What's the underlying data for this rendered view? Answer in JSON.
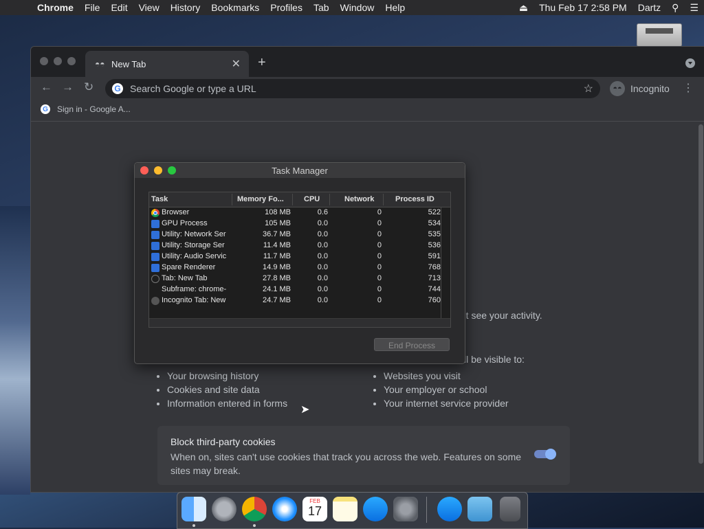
{
  "menubar": {
    "app": "Chrome",
    "items": [
      "File",
      "Edit",
      "View",
      "History",
      "Bookmarks",
      "Profiles",
      "Tab",
      "Window",
      "Help"
    ],
    "datetime": "Thu Feb 17  2:58 PM",
    "user": "Dartz"
  },
  "browser": {
    "tab_title": "New Tab",
    "omnibox_placeholder": "Search Google or type a URL",
    "incognito_label": "Incognito",
    "bookmark": "Sign in - Google A..."
  },
  "ntp": {
    "activity_fragment": "'t see your activity.",
    "visible_fragment": "ll be visible to:",
    "left_bullets": [
      "Your browsing history",
      "Cookies and site data",
      "Information entered in forms"
    ],
    "right_bullets": [
      "Websites you visit",
      "Your employer or school",
      "Your internet service provider"
    ],
    "cookie_title": "Block third-party cookies",
    "cookie_desc": "When on, sites can't use cookies that track you across the web. Features on some sites may break."
  },
  "task_manager": {
    "title": "Task Manager",
    "columns": [
      "Task",
      "Memory Fo...",
      "CPU",
      "Network",
      "Process ID"
    ],
    "rows": [
      {
        "icon": "chrome",
        "task": "Browser",
        "memory": "108 MB",
        "cpu": "0.6",
        "network": "0",
        "pid": "522"
      },
      {
        "icon": "puzzle",
        "task": "GPU Process",
        "memory": "105 MB",
        "cpu": "0.0",
        "network": "0",
        "pid": "534"
      },
      {
        "icon": "puzzle",
        "task": "Utility: Network Ser",
        "memory": "36.7 MB",
        "cpu": "0.0",
        "network": "0",
        "pid": "535"
      },
      {
        "icon": "puzzle",
        "task": "Utility: Storage Ser",
        "memory": "11.4 MB",
        "cpu": "0.0",
        "network": "0",
        "pid": "536"
      },
      {
        "icon": "puzzle",
        "task": "Utility: Audio Servic",
        "memory": "11.7 MB",
        "cpu": "0.0",
        "network": "0",
        "pid": "591"
      },
      {
        "icon": "puzzle",
        "task": "Spare Renderer",
        "memory": "14.9 MB",
        "cpu": "0.0",
        "network": "0",
        "pid": "768"
      },
      {
        "icon": "tab",
        "task": "Tab: New Tab",
        "memory": "27.8 MB",
        "cpu": "0.0",
        "network": "0",
        "pid": "713"
      },
      {
        "icon": "none",
        "task": "Subframe: chrome-",
        "memory": "24.1 MB",
        "cpu": "0.0",
        "network": "0",
        "pid": "744"
      },
      {
        "icon": "incog",
        "task": "Incognito Tab: New",
        "memory": "24.7 MB",
        "cpu": "0.0",
        "network": "0",
        "pid": "760"
      }
    ],
    "end_process": "End Process"
  },
  "dock": [
    "finder",
    "launchpad",
    "chrome",
    "safari",
    "calendar",
    "notes",
    "app-store",
    "system-preferences",
    "app-store-alt",
    "downloads-folder",
    "trash"
  ],
  "dock_calendar": {
    "month": "FEB",
    "day": "17"
  },
  "colors": {
    "close": "#ff5f57",
    "minimize": "#febc2e",
    "zoom": "#28c840",
    "toggle": "#8ab4f8"
  }
}
